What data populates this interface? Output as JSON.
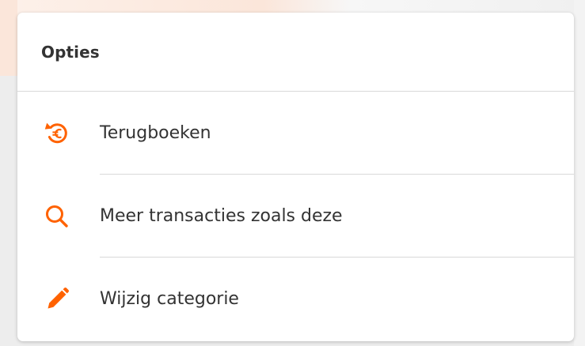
{
  "colors": {
    "accent": "#FF6200",
    "text": "#333333",
    "divider": "#D9D9D9"
  },
  "options_panel": {
    "title": "Opties",
    "items": [
      {
        "label": "Terugboeken",
        "icon": "refund-euro-icon"
      },
      {
        "label": "Meer transacties zoals deze",
        "icon": "search-icon"
      },
      {
        "label": "Wijzig categorie",
        "icon": "pencil-icon"
      }
    ]
  }
}
